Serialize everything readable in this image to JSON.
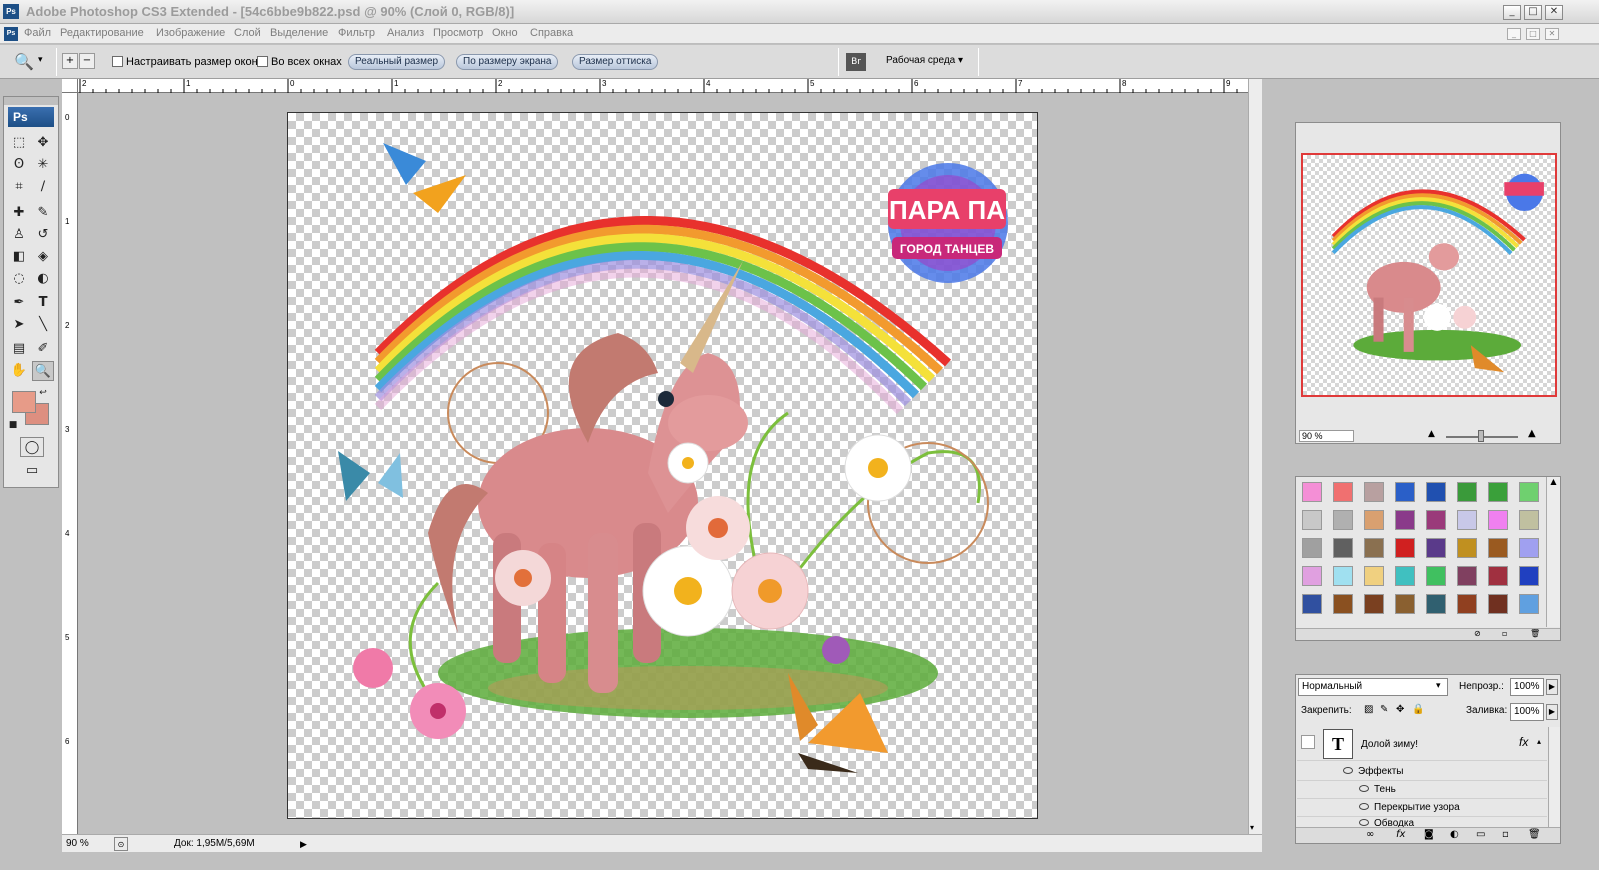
{
  "window": {
    "title": "Adobe Photoshop CS3 Extended - [54c6bbe9b822.psd @ 90% (Слой 0, RGB/8)]",
    "app_badge": "Ps",
    "controls": [
      "_",
      "□",
      "✕"
    ]
  },
  "menubar": {
    "items": [
      "Файл",
      "Редактирование",
      "Изображение",
      "Слой",
      "Выделение",
      "Фильтр",
      "Анализ",
      "Просмотр",
      "Окно",
      "Справка"
    ]
  },
  "options": {
    "resize_windows": "Настраивать размер окон",
    "all_windows": "Во всех окнах",
    "actual_pixels": "Реальный размер",
    "fit_screen": "По размеру экрана",
    "print_size": "Размер оттиска",
    "workspace": "Рабочая среда"
  },
  "rulers": {
    "top": [
      "2",
      "1",
      "0",
      "1",
      "2",
      "3",
      "4",
      "5",
      "6",
      "7",
      "8",
      "9"
    ],
    "left": [
      "0",
      "1",
      "2",
      "3",
      "4",
      "5",
      "6"
    ]
  },
  "status": {
    "zoom": "90 %",
    "doc": "Док: 1,95M/5,69M"
  },
  "toolbox": {
    "logo": "Ps",
    "fg_color": "#e79b88",
    "bg_color": "#dd8f80"
  },
  "canvas": {
    "logo_line1": "ПАРА ПА",
    "logo_line2": "ГОРОД ТАНЦЕВ"
  },
  "navigator": {
    "zoom": "90 %"
  },
  "styles": {
    "swatches": [
      "#f48fd6",
      "#f07070",
      "#b8a0a0",
      "#2a5fc8",
      "#2050b0",
      "#3a9a3a",
      "#3aa03a",
      "#6fd06f",
      "#c8c8c8",
      "#b0b0b0",
      "#d9a070",
      "#8a3a8a",
      "#9a3a7a",
      "#c8c8e8",
      "#f080f0",
      "#c0c0a0",
      "#a0a0a0",
      "#606060",
      "#8a7050",
      "#d02020",
      "#5a3a8a",
      "#c09020",
      "#9a5a20",
      "#a0a0f0",
      "#e0a0e0",
      "#a0e0f0",
      "#f0d080",
      "#40c0c0",
      "#40c060",
      "#804060",
      "#a03040",
      "#2040c0",
      "#3050a0",
      "#8a5020",
      "#7a4020",
      "#8a6030",
      "#306070",
      "#904020",
      "#703020",
      "#60a0e0"
    ]
  },
  "layers": {
    "blend_mode": "Нормальный",
    "opacity_label": "Непрозр.:",
    "opacity": "100%",
    "lock_label": "Закрепить:",
    "fill_label": "Заливка:",
    "fill": "100%",
    "rows": [
      {
        "name": "Долой зиму!",
        "type": "T"
      },
      {
        "name": "Эффекты"
      },
      {
        "name": "Тень"
      },
      {
        "name": "Перекрытие узора"
      },
      {
        "name": "Обводка"
      }
    ]
  }
}
